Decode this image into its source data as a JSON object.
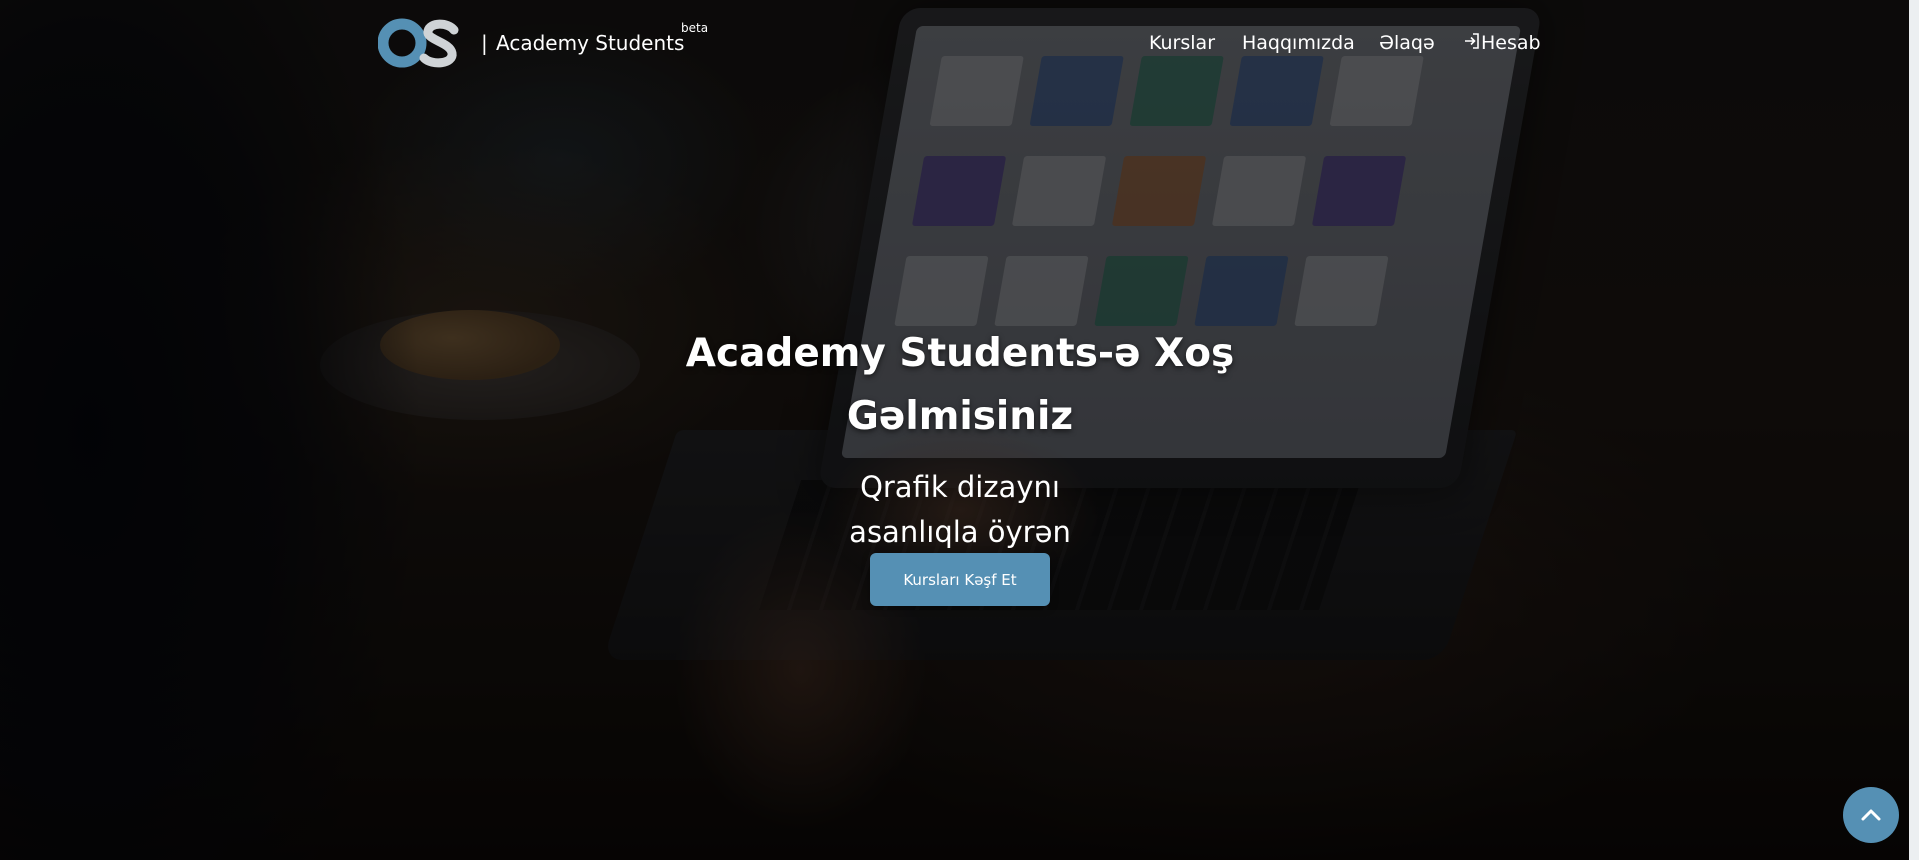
{
  "brand": {
    "logo_text": "OS",
    "separator": "|",
    "name": "Academy Students",
    "badge": "beta",
    "logo_colors": {
      "o": "#5590b4",
      "s": "#cfd3d6"
    }
  },
  "nav": {
    "items": [
      {
        "label": "Kurslar"
      },
      {
        "label": "Haqqımızda"
      },
      {
        "label": "Əlaqə"
      },
      {
        "label": "Hesab",
        "icon": "login-icon"
      }
    ]
  },
  "hero": {
    "title_lines": [
      "Academy Students-ə Xoş",
      "Gəlmisiniz"
    ],
    "subtitle_lines": [
      "Qrafik dizaynı",
      "asanlıqla öyrən"
    ],
    "cta_label": "Kursları Kəşf Et"
  },
  "scroll_top": {
    "icon": "chevron-up-icon"
  },
  "colors": {
    "accent": "#5590b4",
    "text": "#ffffff",
    "overlay": "rgba(0,0,0,0.58)"
  }
}
